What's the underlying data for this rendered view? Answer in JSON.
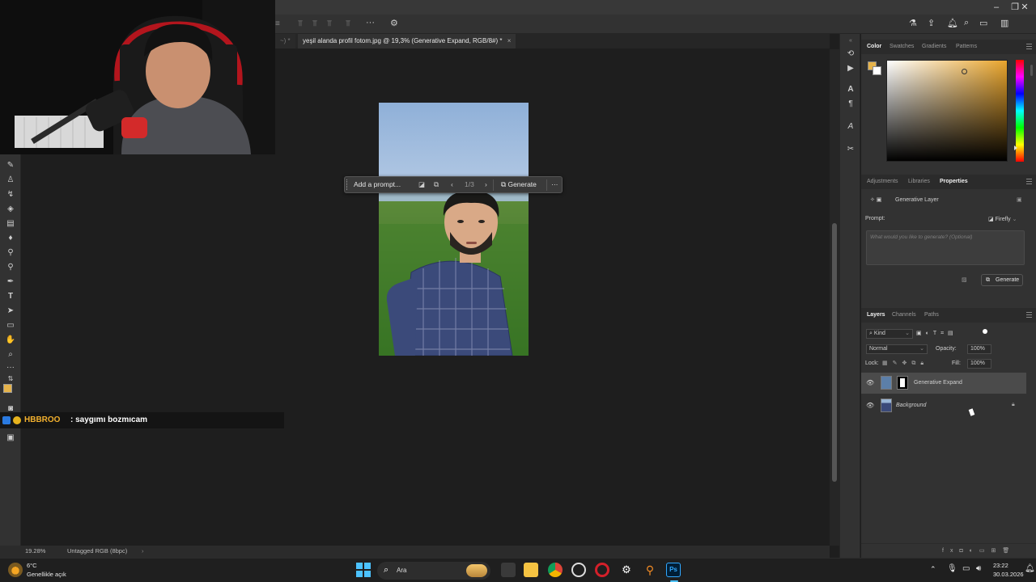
{
  "window": {
    "document_tab_prev": "~) *",
    "document_tab": "yeşil alanda profil fotom.jpg @ 19,3% (Generative Expand, RGB/8#) *",
    "close_glyph": "×"
  },
  "contextual_bar": {
    "prompt_placeholder": "Add a prompt...",
    "counter": "1/3",
    "generate_label": "Generate",
    "more_glyph": "···"
  },
  "color_panel": {
    "tabs": [
      "Color",
      "Swatches",
      "Gradients",
      "Patterns"
    ]
  },
  "properties_panel": {
    "tabs": [
      "Adjustments",
      "Libraries",
      "Properties"
    ],
    "layer_type": "Generative Layer",
    "prompt_label": "Prompt:",
    "model_label": "Firefly",
    "prompt_placeholder": "What would you like to generate? (Optional)",
    "generate_label": "Generate"
  },
  "layers_panel": {
    "tabs": [
      "Layers",
      "Channels",
      "Paths"
    ],
    "filter_label": "Kind",
    "blend_mode": "Normal",
    "opacity_label": "Opacity:",
    "opacity_value": "100%",
    "lock_label": "Lock:",
    "fill_label": "Fill:",
    "fill_value": "100%",
    "layers": [
      {
        "name": "Generative Expand",
        "selected": true
      },
      {
        "name": "Background",
        "selected": false
      }
    ]
  },
  "status_bar": {
    "zoom": "19.28%",
    "info": "Untagged RGB (8bpc)"
  },
  "chat": {
    "username": "HBBROO",
    "message": ": saygımı bozmıcam"
  },
  "taskbar": {
    "search_label": "Ara",
    "weather_temp": "6°C",
    "weather_desc": "Genellikle açık",
    "time": "23:22",
    "date": "30.03.2026",
    "ps_label": "Ps"
  },
  "colors": {
    "foreground_swatch": "#e6b34a",
    "chat_username": "#f2b02e",
    "panel_bg": "#323232"
  }
}
